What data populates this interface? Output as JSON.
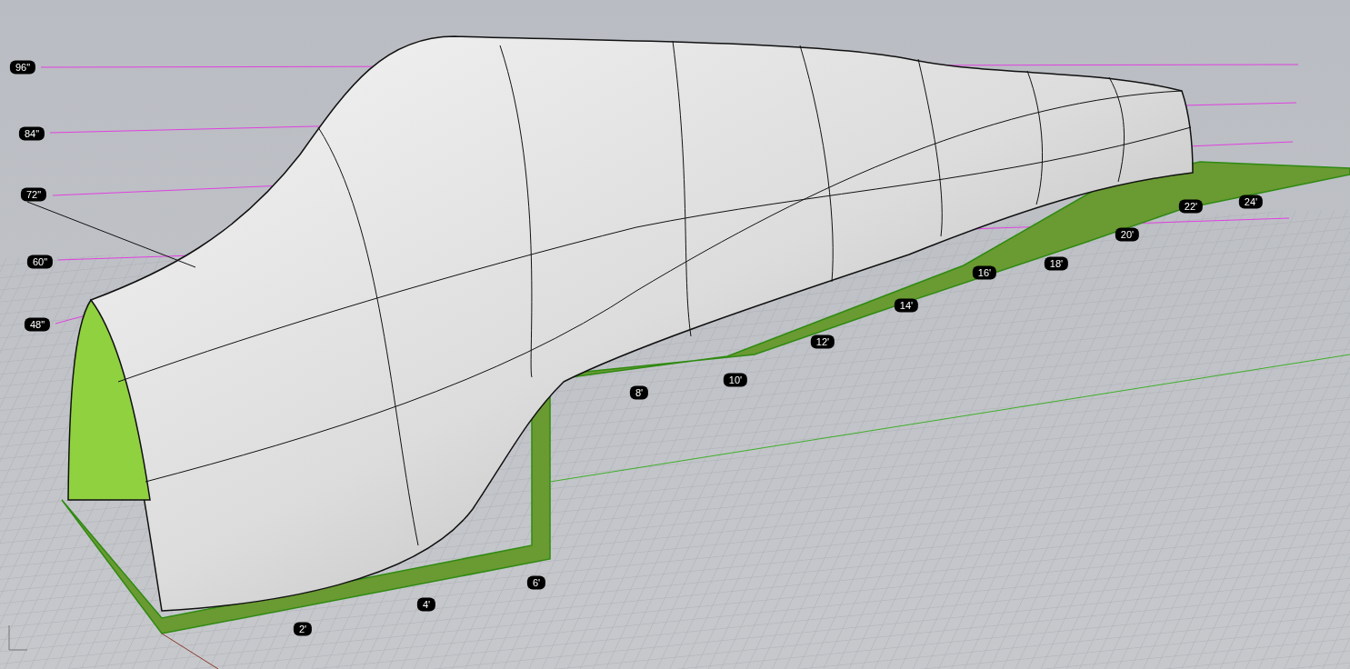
{
  "viewport": {
    "height_labels": [
      "96\"",
      "84\"",
      "72\"",
      "60\"",
      "48\""
    ],
    "length_labels": [
      "2'",
      "4'",
      "6'",
      "8'",
      "10'",
      "12'",
      "14'",
      "16'",
      "18'",
      "20'",
      "22'",
      "24'"
    ]
  }
}
